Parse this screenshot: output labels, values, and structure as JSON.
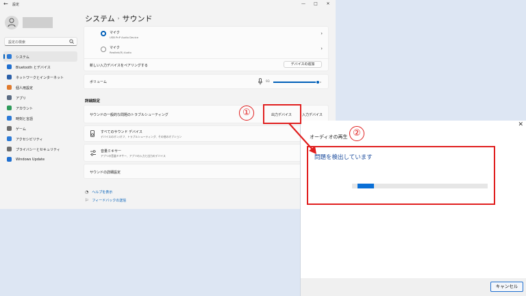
{
  "app": {
    "title": "設定",
    "breadcrumb_parent": "システム",
    "breadcrumb_sep": "›",
    "breadcrumb_current": "サウンド"
  },
  "search": {
    "placeholder": "設定の検索"
  },
  "sidebar": {
    "items": [
      {
        "label": "システム",
        "icon": "system-icon",
        "color": "#2c7ad6",
        "active": true
      },
      {
        "label": "Bluetooth とデバイス",
        "icon": "bluetooth-icon",
        "color": "#1f6fd0"
      },
      {
        "label": "ネットワークとインターネット",
        "icon": "wifi-icon",
        "color": "#2a5fa8"
      },
      {
        "label": "個人用設定",
        "icon": "brush-icon",
        "color": "#e07a2c"
      },
      {
        "label": "アプリ",
        "icon": "apps-icon",
        "color": "#5a6b82"
      },
      {
        "label": "アカウント",
        "icon": "account-icon",
        "color": "#2e9a5a"
      },
      {
        "label": "時刻と言語",
        "icon": "clock-globe-icon",
        "color": "#2c7ad6"
      },
      {
        "label": "ゲーム",
        "icon": "game-icon",
        "color": "#6b6b6b"
      },
      {
        "label": "アクセシビリティ",
        "icon": "accessibility-icon",
        "color": "#2c7ad6"
      },
      {
        "label": "プライバシーとセキュリティ",
        "icon": "shield-icon",
        "color": "#6b6b6b"
      },
      {
        "label": "Windows Update",
        "icon": "update-icon",
        "color": "#1f6fd0"
      }
    ]
  },
  "input_devices": {
    "mic1": {
      "name": "マイク",
      "detail": "USB PnP Audio Device",
      "selected": true
    },
    "mic2": {
      "name": "マイク",
      "detail": "Realtek(R) Audio",
      "selected": false
    },
    "pair_label": "新しい入力デバイスをペアリングする",
    "add_button": "デバイスの追加"
  },
  "volume": {
    "label": "ボリューム",
    "value": "93",
    "level": 0.93
  },
  "advanced": {
    "heading": "詳細設定",
    "troubleshoot_label": "サウンドの一般的な問題のトラブルシューティング",
    "output_devices_button": "出力デバイス",
    "input_devices_button": "入力デバイス",
    "all_devices_title": "すべてのサウンド デバイス",
    "all_devices_sub": "デバイスのオン/オフ、トラブルシューティング、その他のオプション",
    "mixer_title": "音量ミキサー",
    "mixer_sub": "アプリの音量ミキサー、アプリの入力と出力のデバイス",
    "more_settings": "サウンドの詳細設定"
  },
  "help": {
    "get_help": "ヘルプを表示",
    "feedback": "フィードバックの送信"
  },
  "annotations": {
    "step1": "①",
    "step2": "②"
  },
  "dialog": {
    "title": "オーディオの再生",
    "heading": "問題を検出しています",
    "progress": 0.12,
    "cancel": "キャンセル",
    "close": "✕"
  }
}
